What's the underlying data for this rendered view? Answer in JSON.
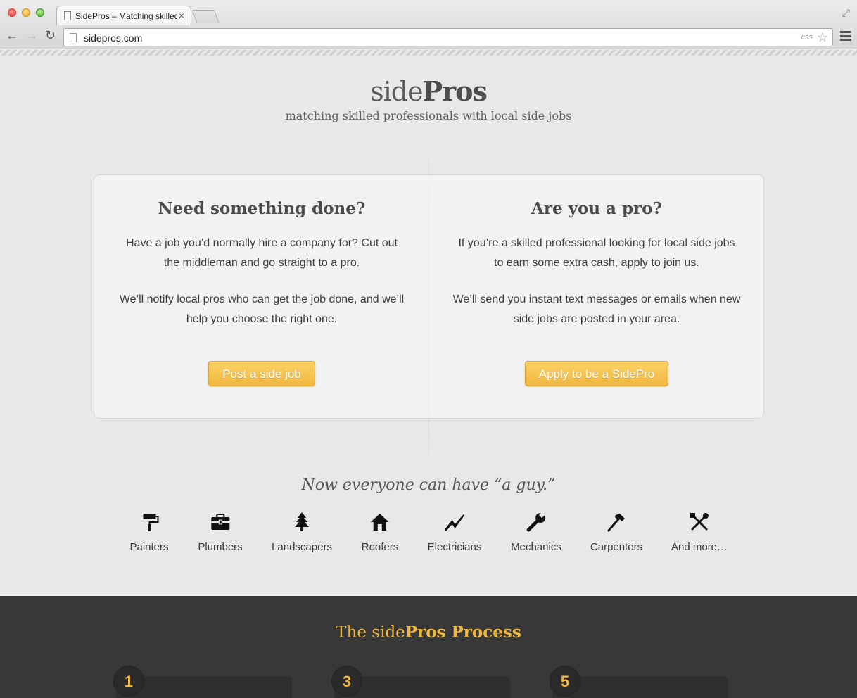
{
  "browser": {
    "tab_title": "SidePros – Matching skilled professionals with local side jobs",
    "url": "sidepros.com",
    "css_badge": "css"
  },
  "site": {
    "logo_light": "side",
    "logo_bold": "Pros",
    "tagline": "matching skilled professionals with local side jobs"
  },
  "need": {
    "title": "Need something done?",
    "para1": "Have a job you’d normally hire a company for? Cut out the middleman and go straight to a pro.",
    "para2": "We’ll notify local pros who can get the job done, and we’ll help you choose the right one.",
    "button": "Post a side job"
  },
  "pro": {
    "title": "Are you a pro?",
    "para1": "If you’re a skilled professional looking for local side jobs to earn some extra cash, apply to join us.",
    "para2": "We’ll send you instant text messages or emails when new side jobs are posted in your area.",
    "button": "Apply to be a SidePro"
  },
  "guy_heading": "Now everyone can have “a guy.”",
  "trades": [
    {
      "label": "Painters",
      "icon": "paint-roller-icon"
    },
    {
      "label": "Plumbers",
      "icon": "toolbox-icon"
    },
    {
      "label": "Landscapers",
      "icon": "tree-icon"
    },
    {
      "label": "Roofers",
      "icon": "house-icon"
    },
    {
      "label": "Electricians",
      "icon": "lightning-icon"
    },
    {
      "label": "Mechanics",
      "icon": "wrench-icon"
    },
    {
      "label": "Carpenters",
      "icon": "hammer-icon"
    },
    {
      "label": "And more…",
      "icon": "tools-icon"
    }
  ],
  "process": {
    "title_prefix": "The side",
    "title_bold": "Pros Process",
    "steps": [
      "1",
      "3",
      "5"
    ]
  },
  "colors": {
    "accent": "#f1b83e",
    "footer_bg": "#383838",
    "page_bg": "#e8e8e8"
  }
}
